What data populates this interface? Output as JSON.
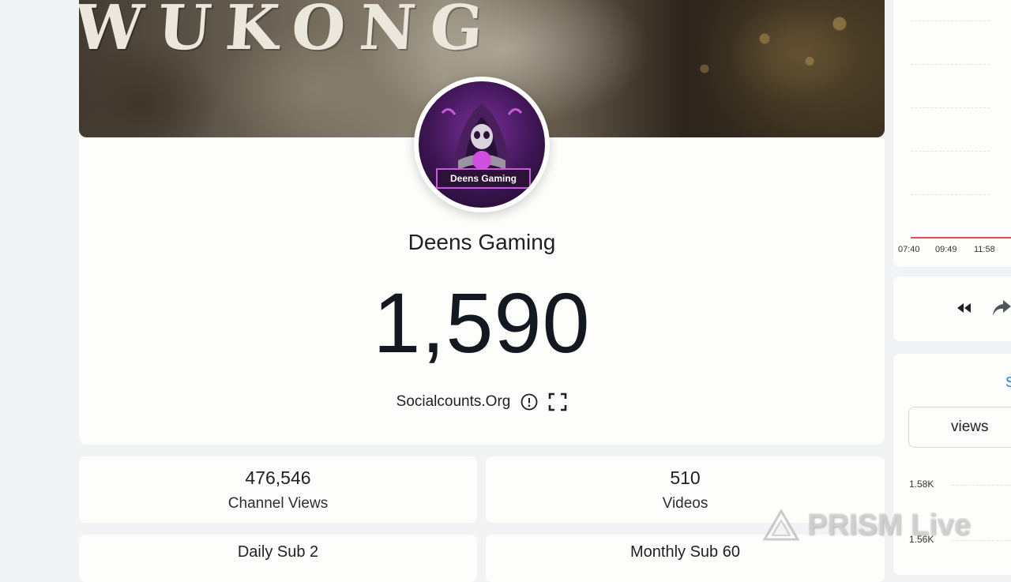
{
  "banner": {
    "title": "WUKONG"
  },
  "channel": {
    "name": "Deens Gaming",
    "avatar_tag": "Deens Gaming",
    "subscriber_count": "1,590"
  },
  "source": {
    "label": "Socialcounts.Org",
    "info_icon": "info-circle-icon",
    "fullscreen_icon": "fullscreen-icon"
  },
  "stats": {
    "channel_views": {
      "value": "476,546",
      "label": "Channel Views"
    },
    "videos": {
      "value": "510",
      "label": "Videos"
    },
    "daily_sub": "Daily Sub 2",
    "monthly_sub": "Monthly Sub 60"
  },
  "right_chart": {
    "time_ticks": [
      "07:40",
      "09:49",
      "11:58"
    ],
    "line_color": "#e05050"
  },
  "right_controls": {
    "rewind_icon": "rewind-icon",
    "share_icon": "share-icon"
  },
  "right_panel": {
    "link_text": "S",
    "select_value": "views",
    "y_ticks": [
      "1.58K",
      "1.56K"
    ]
  },
  "watermark": {
    "text": "PRISM Live"
  }
}
